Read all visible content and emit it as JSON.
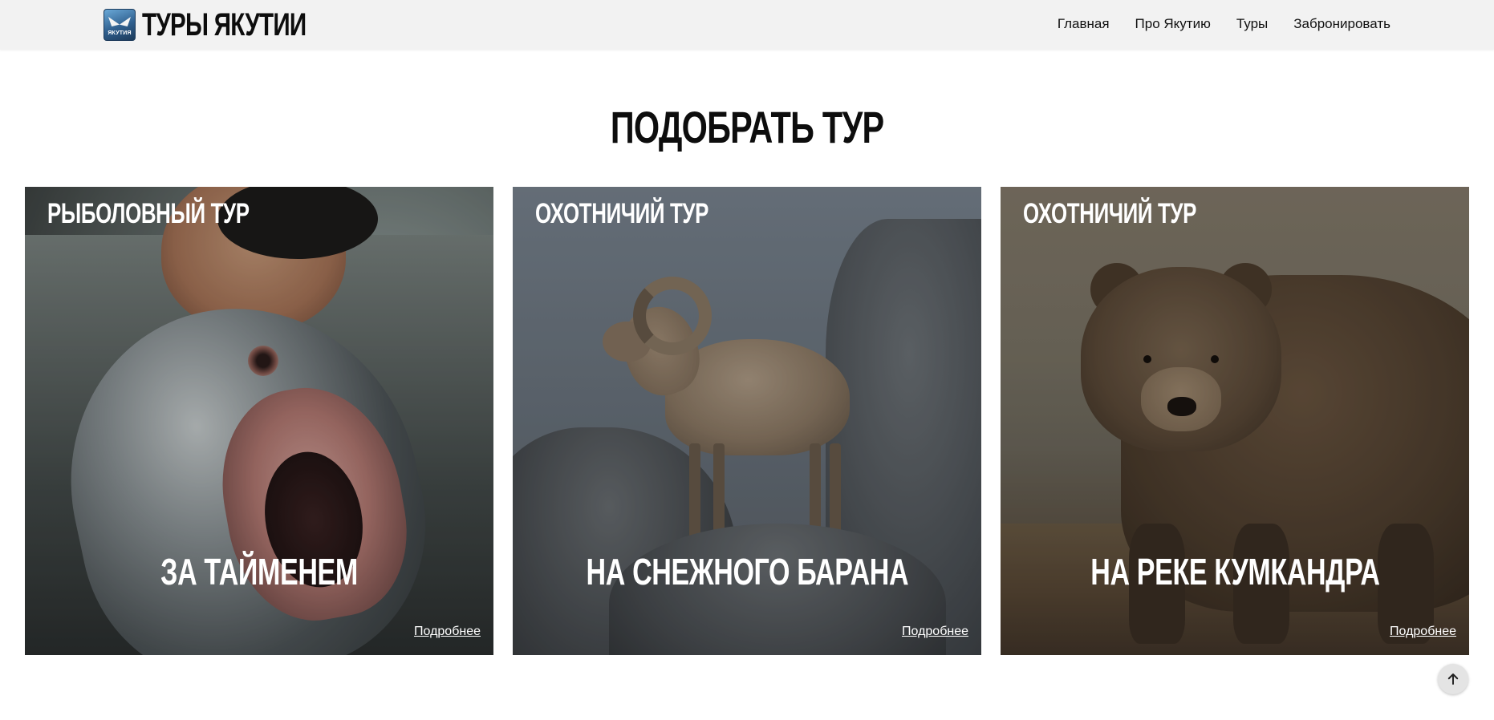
{
  "header": {
    "logo_text": "ТУРЫ ЯКУТИИ",
    "logo_icon_caption": "ЯКУТИЯ",
    "nav": [
      {
        "label": "Главная"
      },
      {
        "label": "Про Якутию"
      },
      {
        "label": "Туры"
      },
      {
        "label": "Забронировать"
      }
    ]
  },
  "section": {
    "title": "ПОДОБРАТЬ ТУР"
  },
  "cards": [
    {
      "category": "РЫБОЛОВНЫЙ ТУР",
      "title": "ЗА ТАЙМЕНЕМ",
      "more": "Подробнее",
      "image": "fisherman-with-taimen-photo"
    },
    {
      "category": "ОХОТНИЧИЙ ТУР",
      "title": "НА СНЕЖНОГО БАРАНА",
      "more": "Подробнее",
      "image": "snow-ram-on-rocks-photo"
    },
    {
      "category": "ОХОТНИЧИЙ ТУР",
      "title": "НА РЕКЕ КУМКАНДРА",
      "more": "Подробнее",
      "image": "brown-bear-photo"
    }
  ],
  "scroll_top": {
    "icon": "arrow-up-icon"
  },
  "colors": {
    "header_bg": "#f2f2f2",
    "page_bg": "#ffffff",
    "card_text": "#ffffff"
  }
}
